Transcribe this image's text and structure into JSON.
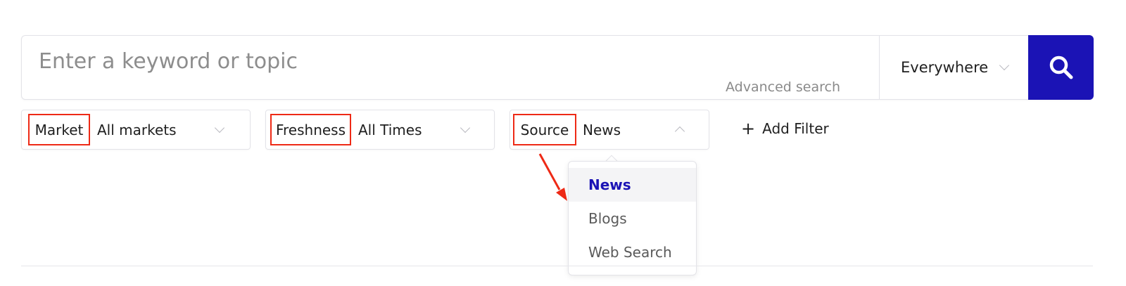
{
  "search": {
    "placeholder": "Enter a keyword or topic",
    "advanced_label": "Advanced search",
    "scope_value": "Everywhere"
  },
  "filters": [
    {
      "name": "Market",
      "value": "All markets"
    },
    {
      "name": "Freshness",
      "value": "All Times"
    },
    {
      "name": "Source",
      "value": "News"
    }
  ],
  "add_filter_label": "Add Filter",
  "source_dropdown": {
    "options": [
      "News",
      "Blogs",
      "Web Search"
    ],
    "selected": "News"
  },
  "colors": {
    "accent": "#1b13b5",
    "annotation": "#ee2a16"
  },
  "icons": {
    "search": "magnifier-icon",
    "chevron": "chevron-down-icon",
    "add": "plus-icon"
  }
}
